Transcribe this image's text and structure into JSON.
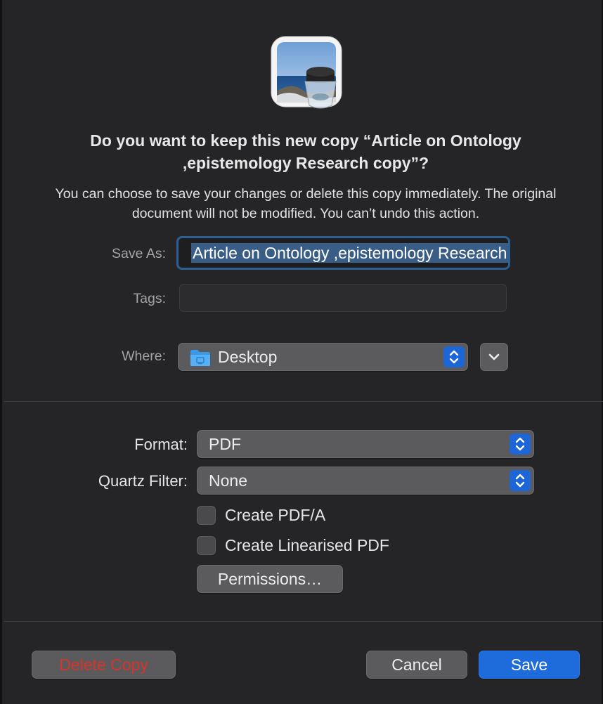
{
  "dialog": {
    "title": "Do you want to keep this new copy “Article on Ontology ,epistemology  Research  copy”?",
    "subtitle": "You can choose to save your changes or delete this copy immediately. The original document will not be modified. You can’t undo this action."
  },
  "save_as": {
    "label": "Save As:",
    "value": "Article on Ontology ,epistemology  Research  copy"
  },
  "tags": {
    "label": "Tags:",
    "value": ""
  },
  "where": {
    "label": "Where:",
    "value": "Desktop",
    "icon": "folder-icon"
  },
  "format": {
    "label": "Format:",
    "value": "PDF"
  },
  "quartz_filter": {
    "label": "Quartz Filter:",
    "value": "None"
  },
  "options": {
    "create_pdfa": {
      "label": "Create PDF/A",
      "checked": false
    },
    "create_linearised": {
      "label": "Create Linearised PDF",
      "checked": false
    }
  },
  "buttons": {
    "permissions": "Permissions…",
    "delete_copy": "Delete Copy",
    "cancel": "Cancel",
    "save": "Save"
  },
  "colors": {
    "accent": "#1e6bdc",
    "destructive": "#d5342b",
    "background": "#252527"
  }
}
